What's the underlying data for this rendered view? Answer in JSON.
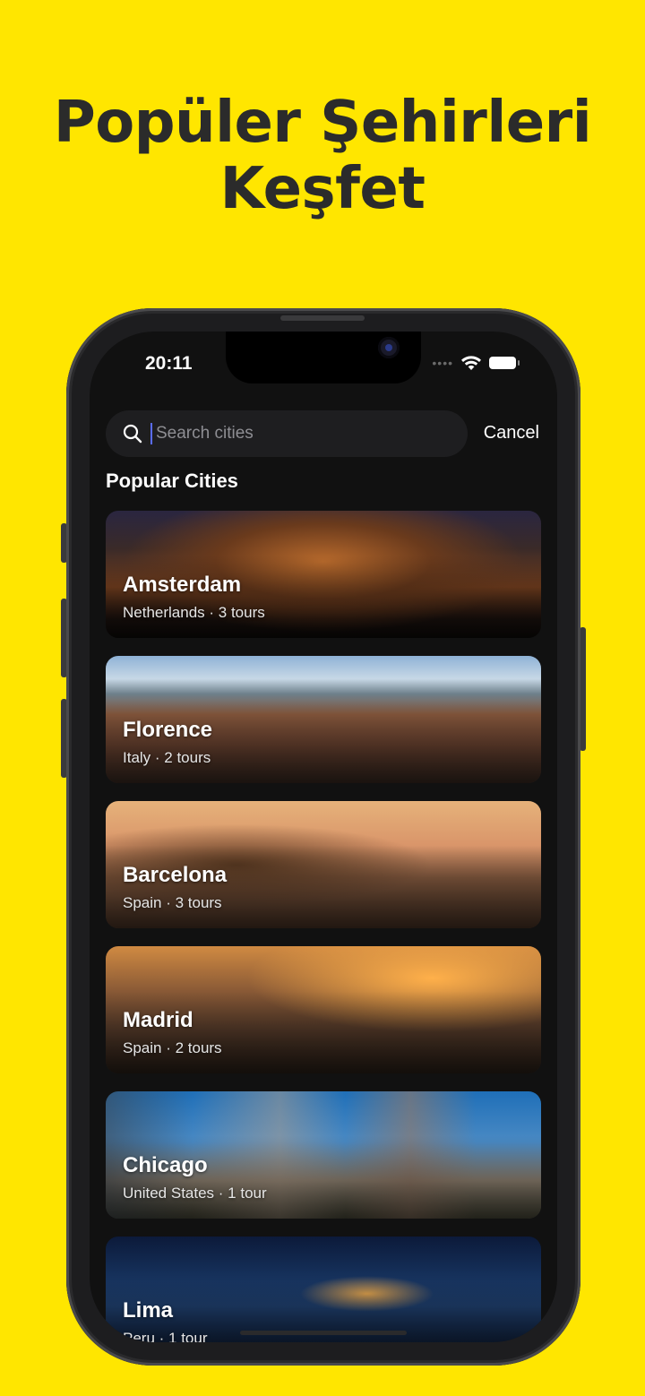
{
  "headline": {
    "line1": "Popüler Şehirleri",
    "line2": "Keşfet"
  },
  "status_bar": {
    "time": "20:11"
  },
  "search": {
    "placeholder": "Search cities",
    "value": "",
    "cancel_label": "Cancel"
  },
  "section_title": "Popular Cities",
  "cities": [
    {
      "name": "Amsterdam",
      "subtitle": "Netherlands · 3 tours"
    },
    {
      "name": "Florence",
      "subtitle": "Italy · 2 tours"
    },
    {
      "name": "Barcelona",
      "subtitle": "Spain · 3 tours"
    },
    {
      "name": "Madrid",
      "subtitle": "Spain · 2 tours"
    },
    {
      "name": "Chicago",
      "subtitle": "United States · 1 tour"
    },
    {
      "name": "Lima",
      "subtitle": "Peru · 1 tour"
    }
  ],
  "colors": {
    "background": "#FFE600",
    "headline": "#2b2b2b",
    "screen": "#111111",
    "caret": "#5a6cff"
  },
  "icons": {
    "search": "magnifier-icon",
    "wifi": "wifi-icon",
    "battery": "battery-icon"
  }
}
